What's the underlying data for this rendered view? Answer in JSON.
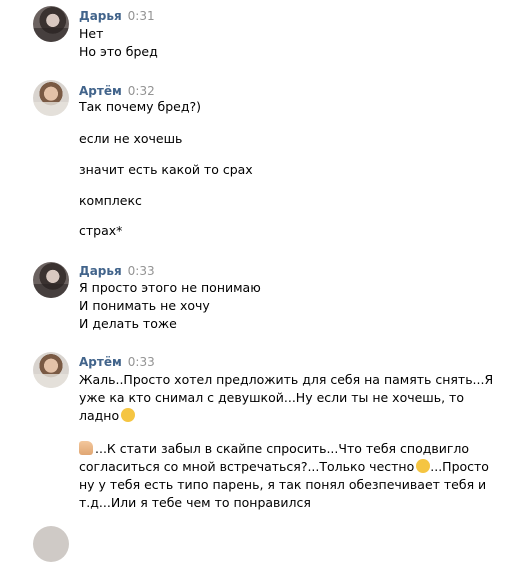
{
  "messages": [
    {
      "author": "Дарья",
      "time": "0:31",
      "lines": [
        "Нет",
        "Но это бред"
      ]
    },
    {
      "author": "Артём",
      "time": "0:32",
      "lines": [
        "Так почему бред?)",
        "если не хочешь",
        "значит есть какой то срах",
        "комплекс",
        "страх*"
      ]
    },
    {
      "author": "Дарья",
      "time": "0:33",
      "lines": [
        "Я просто этого не понимаю",
        "И понимать не хочу",
        "И делать тоже"
      ]
    },
    {
      "author": "Артём",
      "time": "0:33",
      "lines": [
        "Жаль..Просто хотел предложить для себя на память снять...Я",
        "уже ка кто снимал с девушкой...Ну если ты не хочешь, то",
        "ладно",
        "...К стати забыл в скайпе спросить...Что тебя сподвигло",
        "согласиться со мной встречаться?...Только честно",
        "...Просто",
        "ну у тебя есть типо парень, я так понял обезпечивает тебя и",
        "т.д...Или я тебе чем то понравился"
      ]
    }
  ]
}
